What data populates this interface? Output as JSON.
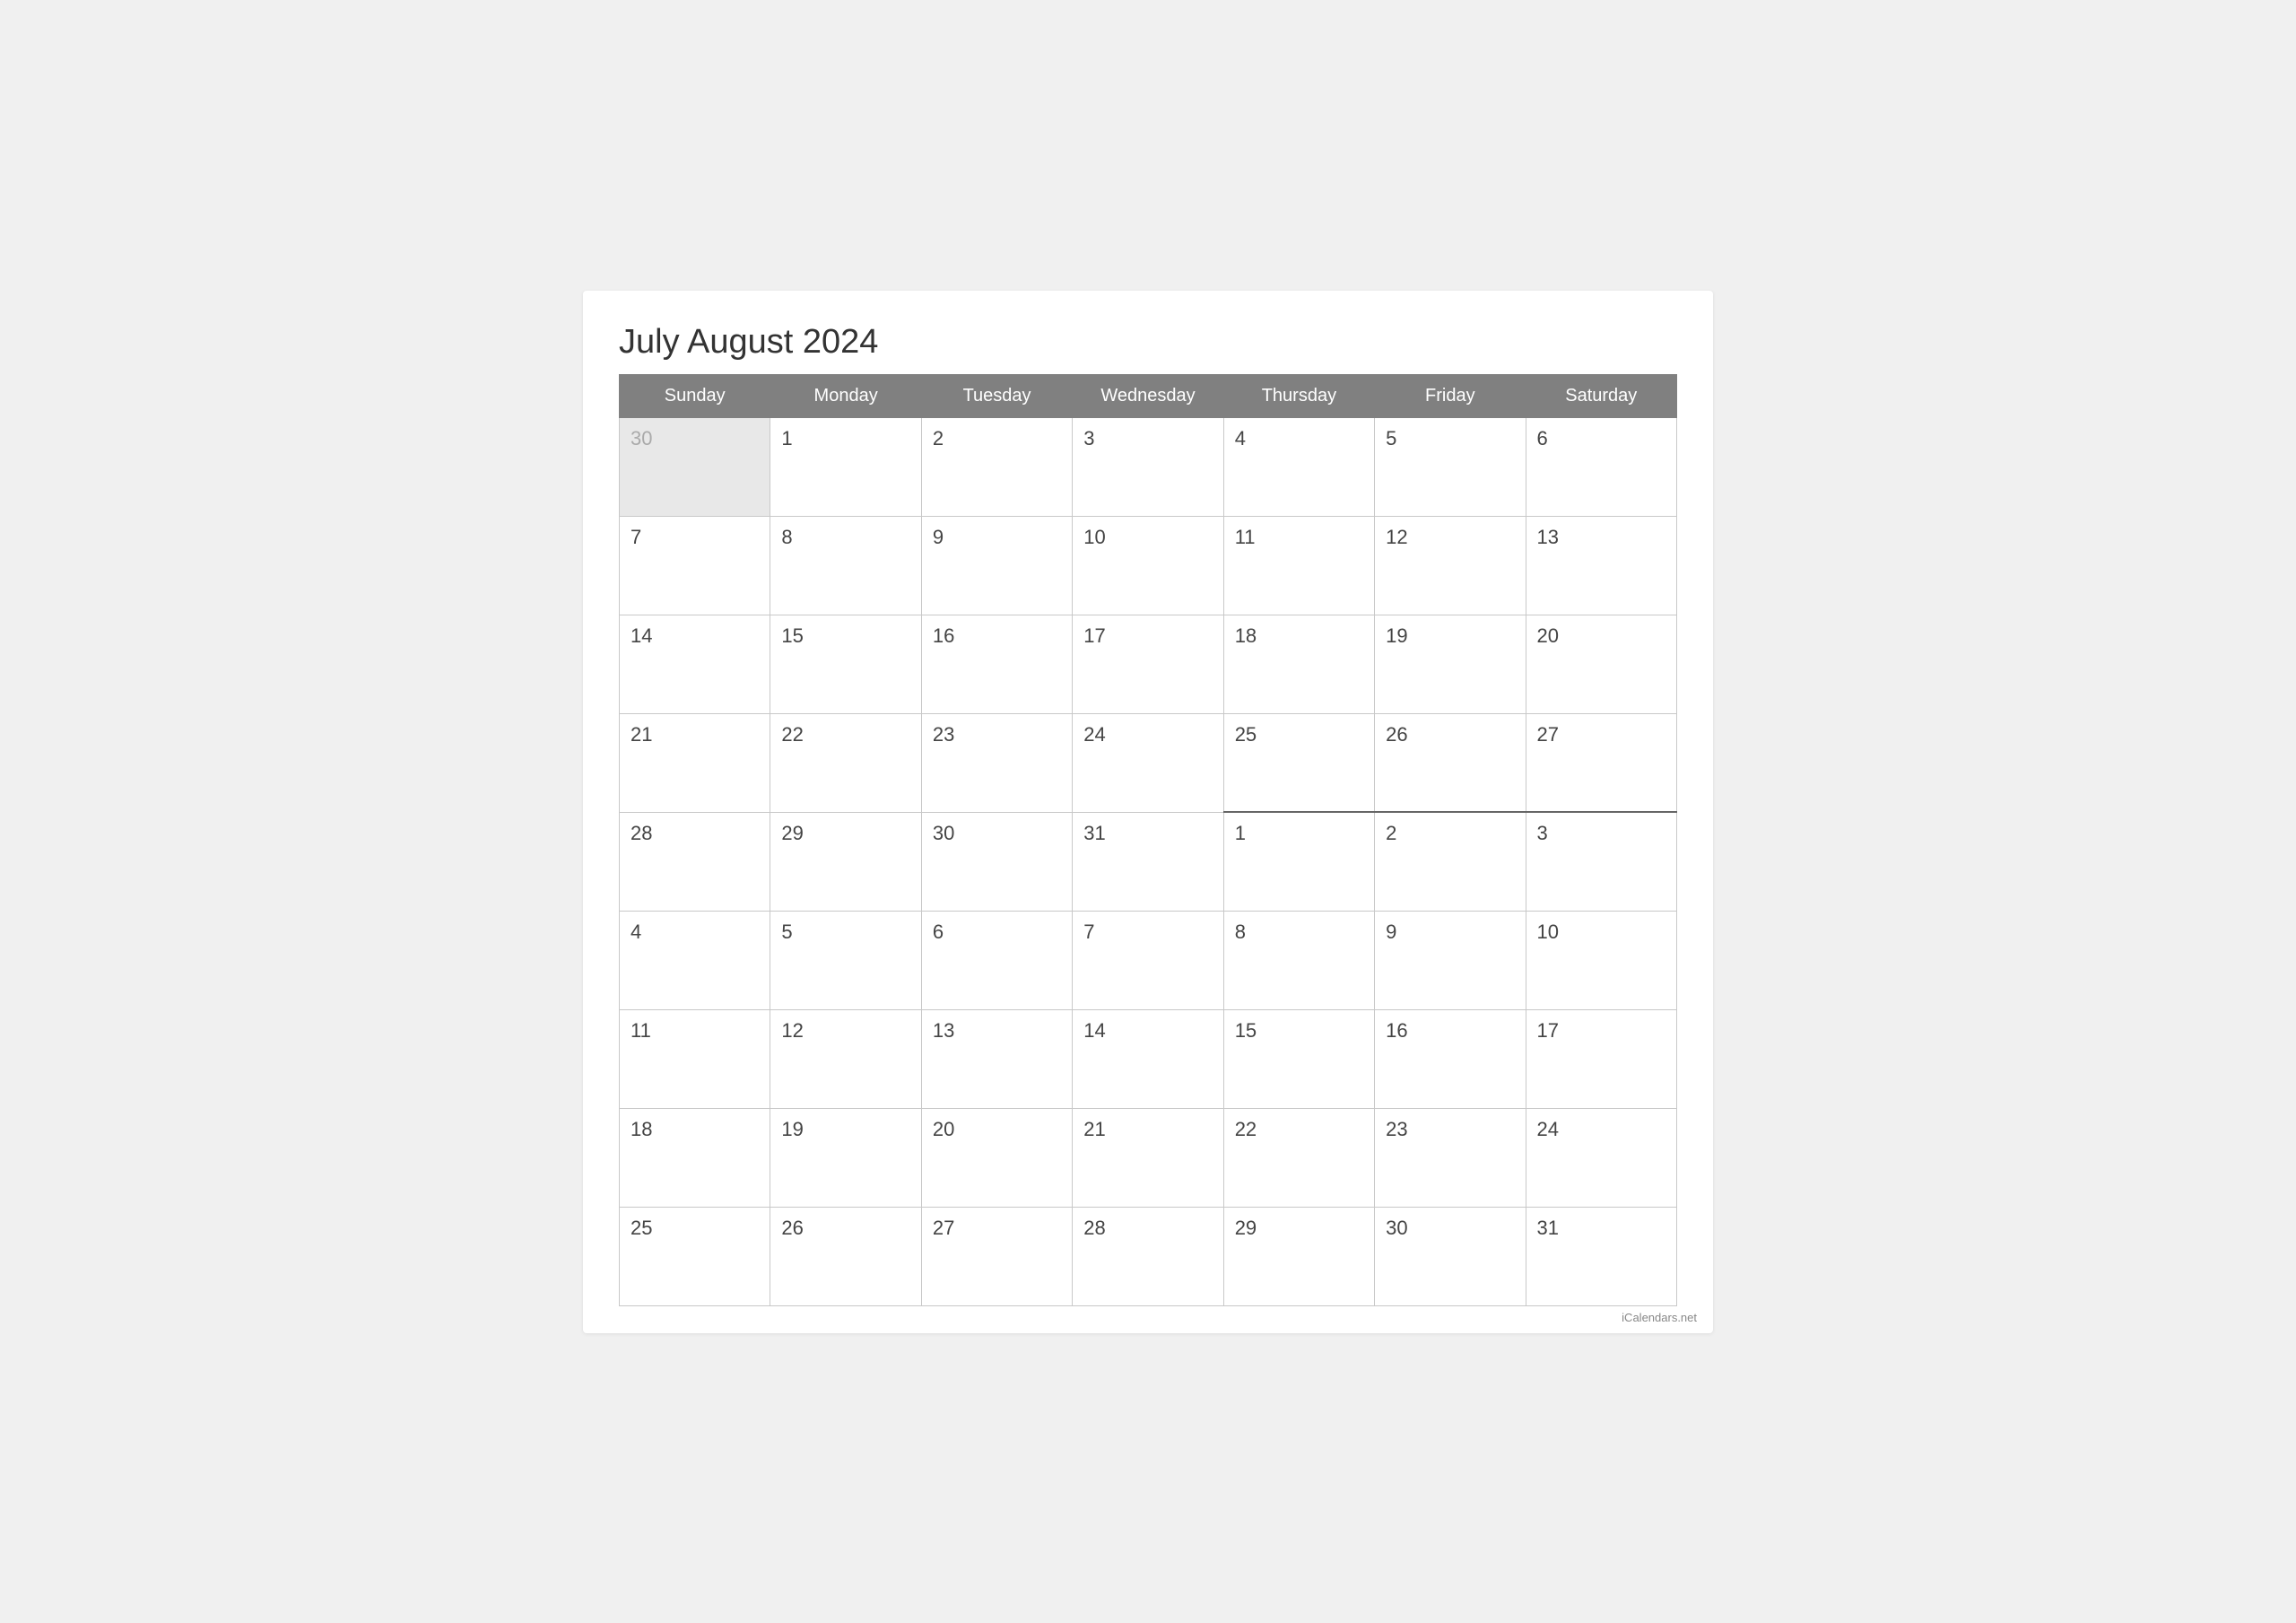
{
  "title": "July August 2024",
  "watermark": "iCalendars.net",
  "headers": [
    "Sunday",
    "Monday",
    "Tuesday",
    "Wednesday",
    "Thursday",
    "Friday",
    "Saturday"
  ],
  "weeks": [
    {
      "cells": [
        {
          "day": "30",
          "type": "prev-month"
        },
        {
          "day": "1",
          "type": "current"
        },
        {
          "day": "2",
          "type": "current"
        },
        {
          "day": "3",
          "type": "current"
        },
        {
          "day": "4",
          "type": "current"
        },
        {
          "day": "5",
          "type": "current"
        },
        {
          "day": "6",
          "type": "current"
        }
      ]
    },
    {
      "cells": [
        {
          "day": "7",
          "type": "current"
        },
        {
          "day": "8",
          "type": "current"
        },
        {
          "day": "9",
          "type": "current"
        },
        {
          "day": "10",
          "type": "current"
        },
        {
          "day": "11",
          "type": "current"
        },
        {
          "day": "12",
          "type": "current"
        },
        {
          "day": "13",
          "type": "current"
        }
      ]
    },
    {
      "cells": [
        {
          "day": "14",
          "type": "current"
        },
        {
          "day": "15",
          "type": "current"
        },
        {
          "day": "16",
          "type": "current"
        },
        {
          "day": "17",
          "type": "current"
        },
        {
          "day": "18",
          "type": "current"
        },
        {
          "day": "19",
          "type": "current"
        },
        {
          "day": "20",
          "type": "current"
        }
      ]
    },
    {
      "cells": [
        {
          "day": "21",
          "type": "current"
        },
        {
          "day": "22",
          "type": "current"
        },
        {
          "day": "23",
          "type": "current"
        },
        {
          "day": "24",
          "type": "current"
        },
        {
          "day": "25",
          "type": "current"
        },
        {
          "day": "26",
          "type": "current"
        },
        {
          "day": "27",
          "type": "current"
        }
      ]
    },
    {
      "cells": [
        {
          "day": "28",
          "type": "current"
        },
        {
          "day": "29",
          "type": "current"
        },
        {
          "day": "30",
          "type": "current"
        },
        {
          "day": "31",
          "type": "current"
        },
        {
          "day": "1",
          "type": "aug-month"
        },
        {
          "day": "2",
          "type": "aug-month"
        },
        {
          "day": "3",
          "type": "aug-month"
        }
      ]
    },
    {
      "cells": [
        {
          "day": "4",
          "type": "aug-month"
        },
        {
          "day": "5",
          "type": "aug-month"
        },
        {
          "day": "6",
          "type": "aug-month"
        },
        {
          "day": "7",
          "type": "aug-month"
        },
        {
          "day": "8",
          "type": "aug-month"
        },
        {
          "day": "9",
          "type": "aug-month"
        },
        {
          "day": "10",
          "type": "aug-month"
        }
      ]
    },
    {
      "cells": [
        {
          "day": "11",
          "type": "aug-month"
        },
        {
          "day": "12",
          "type": "aug-month"
        },
        {
          "day": "13",
          "type": "aug-month"
        },
        {
          "day": "14",
          "type": "aug-month"
        },
        {
          "day": "15",
          "type": "aug-month"
        },
        {
          "day": "16",
          "type": "aug-month"
        },
        {
          "day": "17",
          "type": "aug-month"
        }
      ]
    },
    {
      "cells": [
        {
          "day": "18",
          "type": "aug-month"
        },
        {
          "day": "19",
          "type": "aug-month"
        },
        {
          "day": "20",
          "type": "aug-month"
        },
        {
          "day": "21",
          "type": "aug-month"
        },
        {
          "day": "22",
          "type": "aug-month"
        },
        {
          "day": "23",
          "type": "aug-month"
        },
        {
          "day": "24",
          "type": "aug-month"
        }
      ]
    },
    {
      "cells": [
        {
          "day": "25",
          "type": "aug-month"
        },
        {
          "day": "26",
          "type": "aug-month"
        },
        {
          "day": "27",
          "type": "aug-month"
        },
        {
          "day": "28",
          "type": "aug-month"
        },
        {
          "day": "29",
          "type": "aug-month"
        },
        {
          "day": "30",
          "type": "aug-month"
        },
        {
          "day": "31",
          "type": "aug-month"
        }
      ]
    }
  ]
}
